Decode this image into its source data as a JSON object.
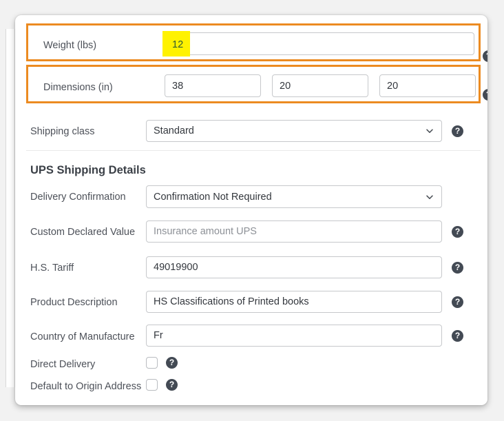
{
  "panel": {
    "section_title": "UPS Shipping Details"
  },
  "weight": {
    "label": "Weight (lbs)",
    "value": "12",
    "placeholder": "",
    "help_icon": "help-question-icon",
    "highlight_color": "#fff200",
    "box_border_color": "#ec8b21"
  },
  "dimensions": {
    "label": "Dimensions (in)",
    "length": "38",
    "width": "20",
    "height": "20",
    "help_icon": "help-question-icon",
    "box_border_color": "#ec8b21"
  },
  "shipping_class": {
    "label": "Shipping class",
    "value": "Standard",
    "chevron_icon": "chevron-down-icon",
    "help_icon": "help-question-icon"
  },
  "delivery_confirmation": {
    "label": "Delivery Confirmation",
    "value": "Confirmation Not Required",
    "chevron_icon": "chevron-down-icon"
  },
  "custom_declared_value": {
    "label": "Custom Declared Value",
    "value": "",
    "placeholder": "Insurance amount UPS",
    "help_icon": "help-question-icon"
  },
  "hs_tariff": {
    "label": "H.S. Tariff",
    "value": "49019900",
    "placeholder": "",
    "help_icon": "help-question-icon"
  },
  "product_description": {
    "label": "Product Description",
    "value": "HS Classifications of Printed books",
    "placeholder": "",
    "help_icon": "help-question-icon"
  },
  "country_of_manufacture": {
    "label": "Country of Manufacture",
    "value": "Fr",
    "placeholder": "",
    "help_icon": "help-question-icon"
  },
  "direct_delivery": {
    "label": "Direct Delivery",
    "checked": false,
    "help_icon": "help-question-icon"
  },
  "default_to_origin_address": {
    "label": "Default to Origin Address",
    "checked": false,
    "help_icon": "help-question-icon"
  },
  "icons": {
    "help_glyph": "?"
  },
  "colors": {
    "accent_orange": "#ec8b21",
    "highlight_yellow": "#fff200",
    "help_icon_bg": "#434a54",
    "label_text": "#4d5159",
    "input_border": "#c6c8cb"
  }
}
